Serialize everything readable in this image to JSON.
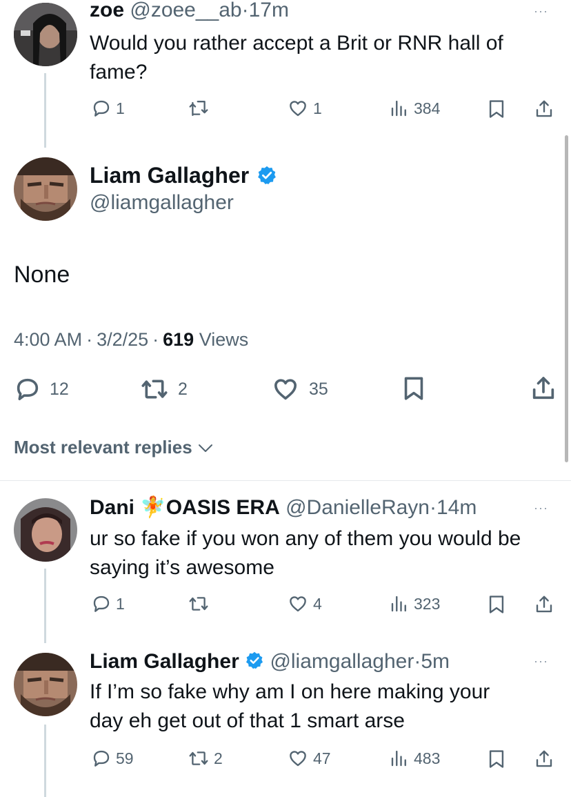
{
  "tweet_zoe": {
    "name": "zoe",
    "handle": "@zoee__ab",
    "separator": "·",
    "time": "17m",
    "text_line1": "Would you rather accept a Brit or RNR hall of",
    "text_line2": "fame?",
    "replies": "1",
    "likes": "1",
    "views": "384"
  },
  "main_tweet": {
    "name": "Liam Gallagher",
    "handle": "@liamgallagher",
    "text": "None",
    "time": "4:00 AM",
    "sep1": "·",
    "date": "3/2/25",
    "sep2": "·",
    "views_count": "619",
    "views_label": "Views",
    "replies": "12",
    "retweets": "2",
    "likes": "35"
  },
  "replies_filter": {
    "label": "Most relevant replies"
  },
  "reply_dani": {
    "name": "Dani",
    "name_emoji": "🧚",
    "name_suffix": "OASIS ERA",
    "handle": "@DanielleRayn",
    "separator": "·",
    "time": "14m",
    "text_line1": "ur so fake if you won any of them you would be",
    "text_line2": "saying it’s awesome",
    "replies": "1",
    "likes": "4",
    "views": "323"
  },
  "reply_liam": {
    "name": "Liam Gallagher",
    "handle": "@liamgallagher",
    "separator": "·",
    "time": "5m",
    "text_line1": "If I’m so fake why am I on here making your",
    "text_line2": "day eh get out of that 1 smart arse",
    "replies": "59",
    "retweets": "2",
    "likes": "47",
    "views": "483"
  },
  "more_glyph": "···",
  "colors": {
    "text": "#0f1419",
    "muted": "#536471",
    "verified": "#1d9bf0",
    "line": "#cfd9de"
  },
  "icons": [
    "reply-icon",
    "retweet-icon",
    "like-icon",
    "views-icon",
    "bookmark-icon",
    "share-icon",
    "verified-badge-icon",
    "chevron-down-icon",
    "more-icon"
  ]
}
